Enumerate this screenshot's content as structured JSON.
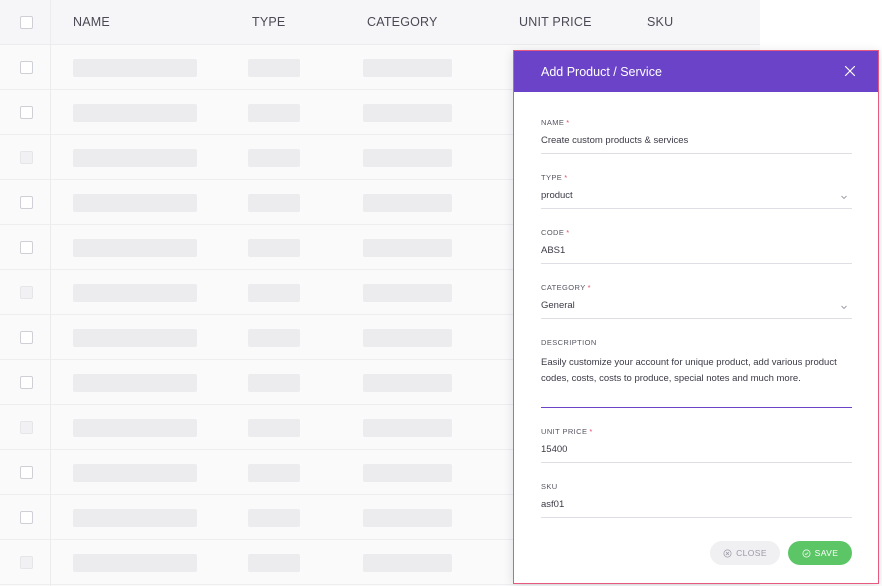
{
  "table": {
    "headers": {
      "name": "NAME",
      "type": "TYPE",
      "category": "CATEGORY",
      "unit_price": "UNIT PRICE",
      "sku": "SKU"
    }
  },
  "modal": {
    "title": "Add Product / Service",
    "fields": {
      "name": {
        "label": "NAME",
        "required": "*",
        "value": "Create custom products & services"
      },
      "type": {
        "label": "TYPE",
        "required": "*",
        "value": "product"
      },
      "code": {
        "label": "CODE",
        "required": "*",
        "value": "ABS1"
      },
      "category": {
        "label": "CATEGORY",
        "required": "*",
        "value": "General"
      },
      "description": {
        "label": "DESCRIPTION",
        "value": "Easily customize your account for unique product, add various product codes, costs, costs to produce, special notes and much more."
      },
      "unit_price": {
        "label": "UNIT PRICE",
        "required": "*",
        "value": "15400"
      },
      "sku": {
        "label": "SKU",
        "value": "asf01"
      }
    },
    "buttons": {
      "close": "CLOSE",
      "save": "SAVE"
    }
  },
  "colors": {
    "header_purple": "#6a43c9",
    "save_green": "#5cc667",
    "required_red": "#e34b6a",
    "modal_border": "#e8597f"
  },
  "icons": {
    "close_modal": "close-icon",
    "select_arrow": "chevron-down-icon",
    "close_button": "circle-x-icon",
    "save_button": "circle-check-icon"
  }
}
